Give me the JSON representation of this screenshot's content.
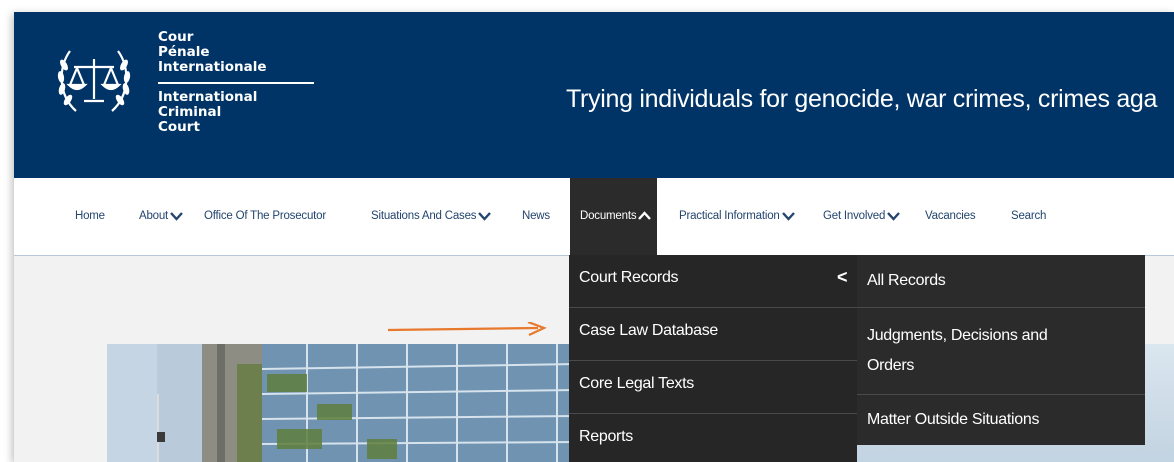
{
  "logo": {
    "fr_line1": "Cour",
    "fr_line2": "Pénale",
    "fr_line3": "Internationale",
    "en_line1": "International",
    "en_line2": "Criminal",
    "en_line3": "Court",
    "icon": "scales-of-justice-laurel-icon"
  },
  "header": {
    "tagline": "Trying individuals for genocide, war crimes, crimes aga"
  },
  "nav": {
    "home": "Home",
    "about": "About",
    "otp": "Office Of The Prosecutor",
    "situations": "Situations And Cases",
    "news": "News",
    "documents": "Documents",
    "practical": "Practical Information",
    "get_involved": "Get Involved",
    "vacancies": "Vacancies",
    "search": "Search"
  },
  "dropdown": {
    "items": [
      "Court Records",
      "Case Law Database",
      "Core Legal Texts",
      "Reports"
    ],
    "back_chevron": "<"
  },
  "submenu": {
    "all_records": "All Records",
    "judgments_line1": "Judgments, Decisions and",
    "judgments_line2": "Orders",
    "matter_outside": "Matter Outside Situations"
  },
  "colors": {
    "header_bg": "#003366",
    "nav_text": "#23456e",
    "dropdown_bg": "#262626",
    "annotation_arrow": "#e8782c"
  }
}
